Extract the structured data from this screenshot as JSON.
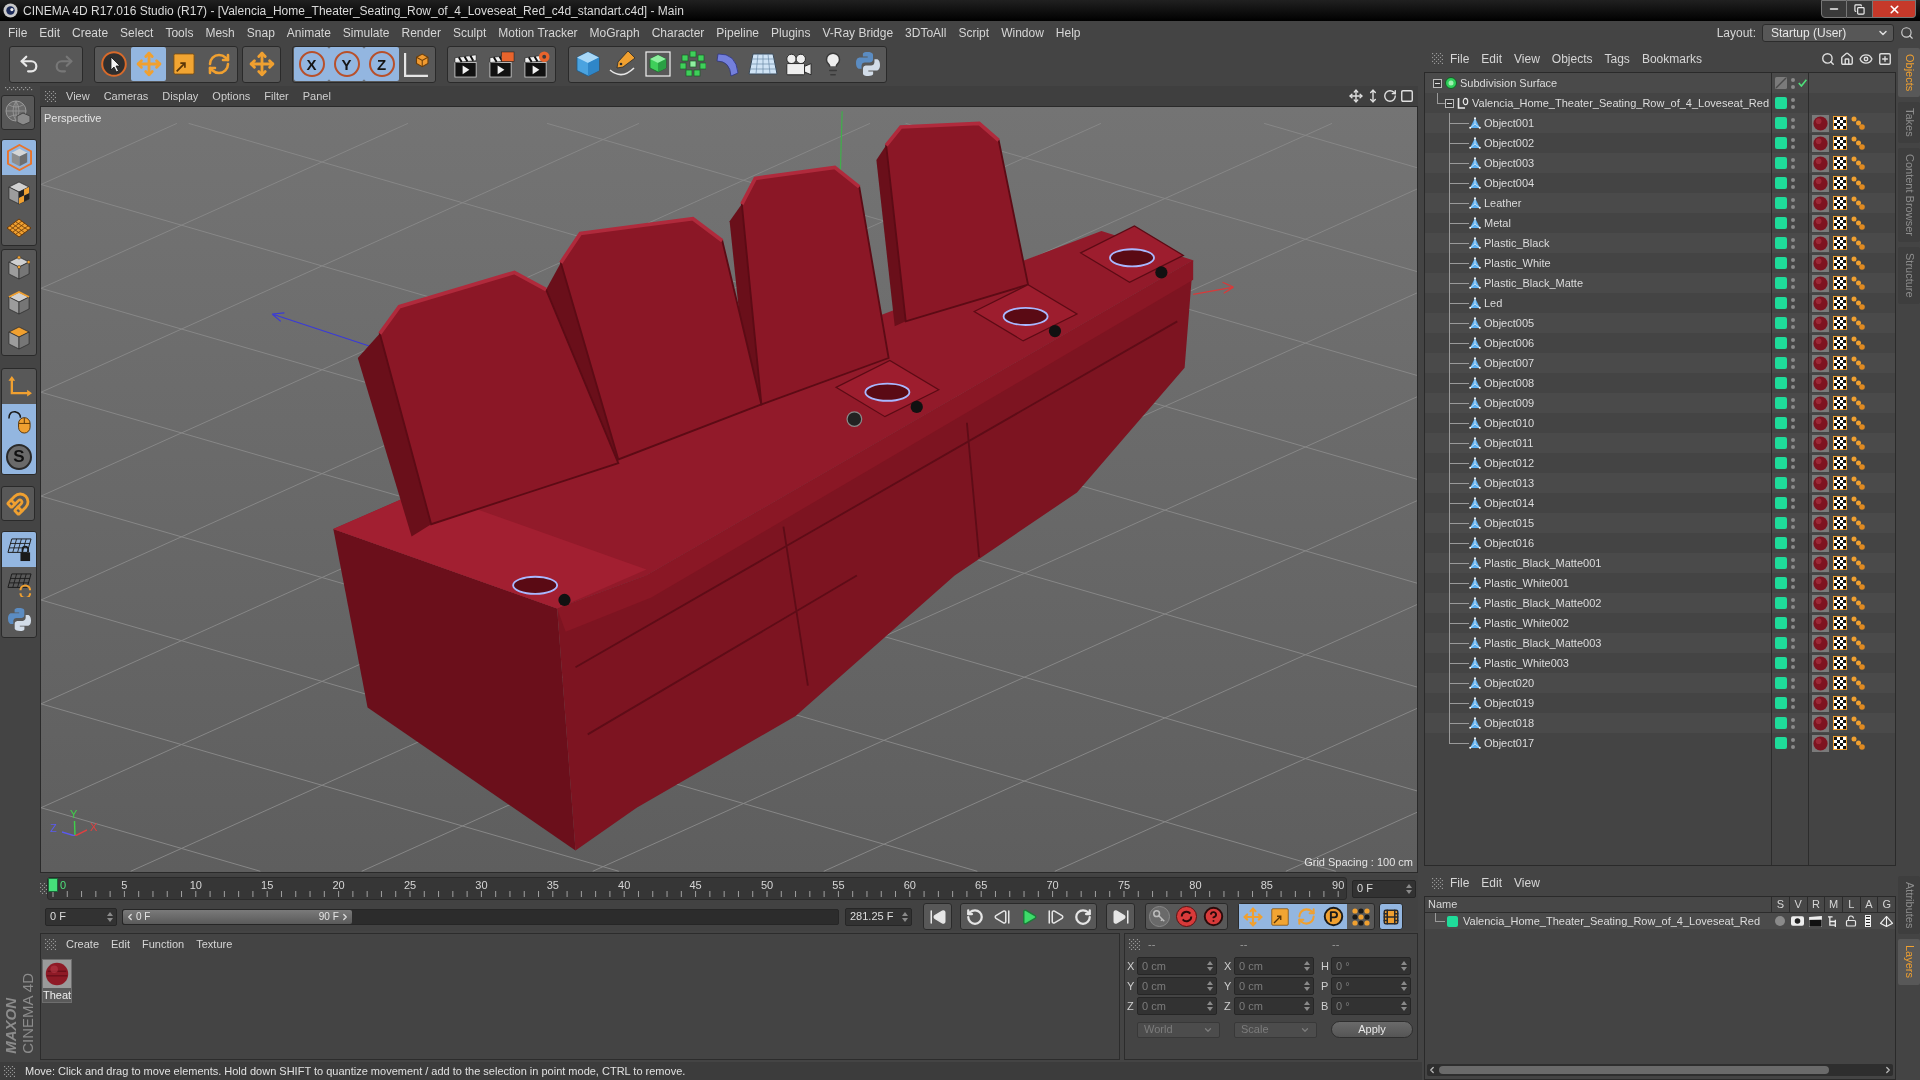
{
  "window": {
    "title": "CINEMA 4D R17.016 Studio (R17) - [Valencia_Home_Theater_Seating_Row_of_4_Loveseat_Red_c4d_standart.c4d] - Main"
  },
  "menu_bar": {
    "items": [
      "File",
      "Edit",
      "Create",
      "Select",
      "Tools",
      "Mesh",
      "Snap",
      "Animate",
      "Simulate",
      "Render",
      "Sculpt",
      "Motion Tracker",
      "MoGraph",
      "Character",
      "Pipeline",
      "Plugins",
      "V-Ray Bridge",
      "3DToAll",
      "Script",
      "Window",
      "Help"
    ],
    "layout_label": "Layout:",
    "layout_value": "Startup (User)"
  },
  "toolbar": {
    "groups": [
      {
        "buttons": [
          {
            "kind": "undo",
            "selected": false,
            "disabled": false
          },
          {
            "kind": "redo",
            "selected": false,
            "disabled": true
          }
        ]
      },
      {
        "buttons": [
          {
            "kind": "live-selection",
            "selected": false
          },
          {
            "kind": "move",
            "selected": true
          },
          {
            "kind": "scale",
            "selected": false
          },
          {
            "kind": "rotate",
            "selected": false
          }
        ]
      },
      {
        "buttons": [
          {
            "kind": "move",
            "selected": false
          }
        ]
      },
      {
        "buttons": [
          {
            "kind": "axis-lock",
            "label": "X",
            "selected": true
          },
          {
            "kind": "axis-lock",
            "label": "Y",
            "selected": true
          },
          {
            "kind": "axis-lock",
            "label": "Z",
            "selected": true
          },
          {
            "kind": "coordinate-system",
            "selected": false
          }
        ]
      },
      {
        "buttons": [
          {
            "kind": "render-view",
            "selected": false
          },
          {
            "kind": "render-picture-viewer",
            "selected": false
          },
          {
            "kind": "render-settings",
            "selected": false
          }
        ]
      },
      {
        "buttons": [
          {
            "kind": "cube",
            "selected": false
          },
          {
            "kind": "spline-pen",
            "selected": false
          },
          {
            "kind": "subdivision",
            "selected": false
          },
          {
            "kind": "cloner",
            "selected": false
          },
          {
            "kind": "deformer",
            "selected": false
          },
          {
            "kind": "floor",
            "selected": false
          },
          {
            "kind": "camera",
            "selected": false
          },
          {
            "kind": "light",
            "selected": false
          },
          {
            "kind": "python",
            "selected": false
          }
        ]
      }
    ]
  },
  "left_toolbar": {
    "groups": [
      {
        "buttons": [
          {
            "kind": "make-editable",
            "selected": false
          }
        ]
      },
      {
        "buttons": [
          {
            "kind": "model",
            "selected": true
          },
          {
            "kind": "texture",
            "selected": false
          },
          {
            "kind": "workplane",
            "selected": false
          }
        ]
      },
      {
        "buttons": [
          {
            "kind": "points",
            "selected": false
          },
          {
            "kind": "edges",
            "selected": false
          },
          {
            "kind": "polygons",
            "selected": false
          }
        ]
      },
      {
        "buttons": [
          {
            "kind": "axis",
            "selected": false
          },
          {
            "kind": "tweak",
            "selected": true
          },
          {
            "kind": "snap",
            "label": "S",
            "selected": true
          }
        ]
      },
      {
        "buttons": [
          {
            "kind": "magnet",
            "selected": false
          }
        ]
      },
      {
        "buttons": [
          {
            "kind": "workplane-lock",
            "selected": true
          },
          {
            "kind": "grid-snap",
            "selected": false
          },
          {
            "kind": "python",
            "selected": false
          }
        ]
      }
    ],
    "logo": {
      "brand": "MAXON",
      "product": "CINEMA 4D"
    }
  },
  "viewport": {
    "menu": [
      "View",
      "Cameras",
      "Display",
      "Options",
      "Filter",
      "Panel"
    ],
    "camera": "Perspective",
    "grid_spacing": "Grid Spacing : 100 cm",
    "gizmo_labels": [
      "Y",
      "Z",
      "X"
    ]
  },
  "timeline": {
    "ticks": [
      "0",
      "5",
      "10",
      "15",
      "20",
      "25",
      "30",
      "35",
      "40",
      "45",
      "50",
      "55",
      "60",
      "65",
      "70",
      "75",
      "80",
      "85",
      "90"
    ],
    "playhead": {
      "level": 0
    },
    "current_frame": "0 F",
    "start_frame": "0 F",
    "range": {
      "start": "0 F",
      "end": "90 F",
      "level": 0.32
    },
    "end_frame": "281.25 F",
    "transport": [
      {
        "kind": "go-start"
      },
      {
        "kind": "prev-key"
      },
      {
        "kind": "step-back"
      },
      {
        "kind": "play"
      },
      {
        "kind": "step-forward"
      },
      {
        "kind": "next-key"
      },
      {
        "kind": "go-end"
      }
    ],
    "record": [
      {
        "kind": "key"
      },
      {
        "kind": "record"
      },
      {
        "kind": "autokey"
      }
    ],
    "key_filters": [
      {
        "kind": "position",
        "selected": true
      },
      {
        "kind": "scale",
        "selected": true
      },
      {
        "kind": "rotation",
        "selected": true
      },
      {
        "kind": "parameter",
        "selected": true
      },
      {
        "kind": "point-level",
        "selected": false
      }
    ],
    "timeline_button": {
      "selected": true
    }
  },
  "materials": {
    "menu": [
      "Create",
      "Edit",
      "Function",
      "Texture"
    ],
    "items": [
      {
        "name": "Theat"
      }
    ]
  },
  "coordinates": {
    "headers": [
      "--",
      "--",
      "--"
    ],
    "rows": [
      [
        {
          "label": "X",
          "value": "0 cm"
        },
        {
          "label": "X",
          "value": "0 cm"
        },
        {
          "label": "H",
          "value": "0 °"
        }
      ],
      [
        {
          "label": "Y",
          "value": "0 cm"
        },
        {
          "label": "Y",
          "value": "0 cm"
        },
        {
          "label": "P",
          "value": "0 °"
        }
      ],
      [
        {
          "label": "Z",
          "value": "0 cm"
        },
        {
          "label": "Z",
          "value": "0 cm"
        },
        {
          "label": "B",
          "value": "0 °"
        }
      ]
    ],
    "disabled": true,
    "space": "World",
    "size_mode": "Scale",
    "apply": "Apply"
  },
  "status_bar": {
    "text": "Move: Click and drag to move elements. Hold down SHIFT to quantize movement / add to the selection in point mode, CTRL to remove."
  },
  "objects_manager": {
    "menu": [
      "File",
      "Edit",
      "View",
      "Objects",
      "Tags",
      "Bookmarks"
    ],
    "tree": [
      {
        "name": "Subdivision Surface",
        "kind": "subdivision",
        "expanded": true,
        "enabled": true,
        "children": [
          {
            "name": "Valencia_Home_Theater_Seating_Row_of_4_Loveseat_Red",
            "kind": "null",
            "expanded": true,
            "color": "#1fdc9a",
            "children": [
              {
                "name": "Object001",
                "kind": "polygon",
                "color": "#1fdc9a"
              },
              {
                "name": "Object002",
                "kind": "polygon",
                "color": "#1fdc9a"
              },
              {
                "name": "Object003",
                "kind": "polygon",
                "color": "#1fdc9a"
              },
              {
                "name": "Object004",
                "kind": "polygon",
                "color": "#1fdc9a"
              },
              {
                "name": "Leather",
                "kind": "polygon",
                "color": "#1fdc9a"
              },
              {
                "name": "Metal",
                "kind": "polygon",
                "color": "#1fdc9a"
              },
              {
                "name": "Plastic_Black",
                "kind": "polygon",
                "color": "#1fdc9a"
              },
              {
                "name": "Plastic_White",
                "kind": "polygon",
                "color": "#1fdc9a"
              },
              {
                "name": "Plastic_Black_Matte",
                "kind": "polygon",
                "color": "#1fdc9a"
              },
              {
                "name": "Led",
                "kind": "polygon",
                "color": "#1fdc9a"
              },
              {
                "name": "Object005",
                "kind": "polygon",
                "color": "#1fdc9a"
              },
              {
                "name": "Object006",
                "kind": "polygon",
                "color": "#1fdc9a"
              },
              {
                "name": "Object007",
                "kind": "polygon",
                "color": "#1fdc9a"
              },
              {
                "name": "Object008",
                "kind": "polygon",
                "color": "#1fdc9a"
              },
              {
                "name": "Object009",
                "kind": "polygon",
                "color": "#1fdc9a"
              },
              {
                "name": "Object010",
                "kind": "polygon",
                "color": "#1fdc9a"
              },
              {
                "name": "Object011",
                "kind": "polygon",
                "color": "#1fdc9a"
              },
              {
                "name": "Object012",
                "kind": "polygon",
                "color": "#1fdc9a"
              },
              {
                "name": "Object013",
                "kind": "polygon",
                "color": "#1fdc9a"
              },
              {
                "name": "Object014",
                "kind": "polygon",
                "color": "#1fdc9a"
              },
              {
                "name": "Object015",
                "kind": "polygon",
                "color": "#1fdc9a"
              },
              {
                "name": "Object016",
                "kind": "polygon",
                "color": "#1fdc9a"
              },
              {
                "name": "Plastic_Black_Matte001",
                "kind": "polygon",
                "color": "#1fdc9a"
              },
              {
                "name": "Plastic_White001",
                "kind": "polygon",
                "color": "#1fdc9a"
              },
              {
                "name": "Plastic_Black_Matte002",
                "kind": "polygon",
                "color": "#1fdc9a"
              },
              {
                "name": "Plastic_White002",
                "kind": "polygon",
                "color": "#1fdc9a"
              },
              {
                "name": "Plastic_Black_Matte003",
                "kind": "polygon",
                "color": "#1fdc9a"
              },
              {
                "name": "Plastic_White003",
                "kind": "polygon",
                "color": "#1fdc9a"
              },
              {
                "name": "Object020",
                "kind": "polygon",
                "color": "#1fdc9a"
              },
              {
                "name": "Object019",
                "kind": "polygon",
                "color": "#1fdc9a"
              },
              {
                "name": "Object018",
                "kind": "polygon",
                "color": "#1fdc9a"
              },
              {
                "name": "Object017",
                "kind": "polygon",
                "color": "#1fdc9a"
              }
            ]
          }
        ]
      }
    ],
    "tabs": [
      {
        "label": "Objects",
        "selected": true
      },
      {
        "label": "Takes",
        "selected": false
      },
      {
        "label": "Content Browser",
        "selected": false
      },
      {
        "label": "Structure",
        "selected": false
      }
    ]
  },
  "layers_manager": {
    "menu": [
      "File",
      "Edit",
      "View"
    ],
    "columns": [
      "Name",
      "S",
      "V",
      "R",
      "M",
      "L",
      "A",
      "G"
    ],
    "rows": [
      {
        "name": "Valencia_Home_Theater_Seating_Row_of_4_Loveseat_Red",
        "color": "#1fdc9a"
      }
    ],
    "tabs": [
      {
        "label": "Attributes",
        "selected": false
      },
      {
        "label": "Layers",
        "selected": true
      }
    ]
  }
}
